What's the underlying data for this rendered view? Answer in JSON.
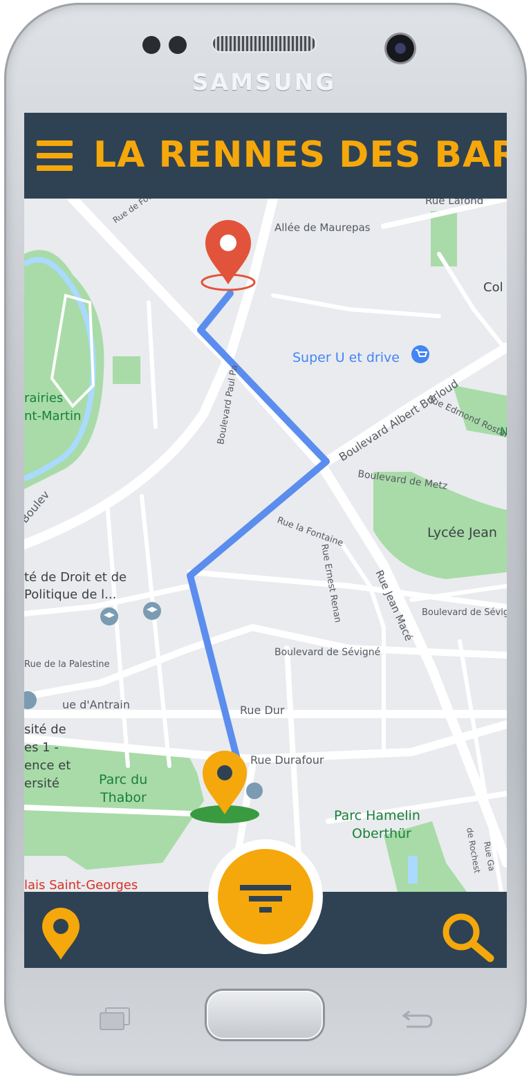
{
  "device": {
    "brand": "SAMSUNG"
  },
  "header": {
    "title": "LA RENNES DES BARS",
    "menu_icon": "menu-icon"
  },
  "map": {
    "streets": [
      "Allée de Maurepas",
      "Rue Lafond",
      "Rue de Fougères",
      "Boulevard Paul Pa",
      "Boulevard Albert Burloud",
      "Rue Edmond Rostand",
      "Boulevard de Metz",
      "Rue la Fontaine",
      "Rue Ernest Renan",
      "Rue Jean Macé",
      "Boulevard de Sévigné",
      "Boulevard de Sévigné",
      "Rue de la Palestine",
      "ue d'Antrain",
      "Rue Dur",
      "Rue Durafour",
      "Boulev",
      "de Rochest",
      "Rue Ga"
    ],
    "places": [
      {
        "name": "Super U et drive",
        "color": "#4285f4"
      },
      {
        "name": "Lycée Jean",
        "color": "#3c4043"
      },
      {
        "name": "Parc du",
        "color": "#188038"
      },
      {
        "name": "Thabor",
        "color": "#188038"
      },
      {
        "name": "Parc Hamelin",
        "color": "#188038"
      },
      {
        "name": "Oberthür",
        "color": "#188038"
      },
      {
        "name": "rairies",
        "color": "#188038"
      },
      {
        "name": "nt-Martin",
        "color": "#188038"
      },
      {
        "name": "té de Droit et de",
        "color": "#3c4043"
      },
      {
        "name": "Politique de l...",
        "color": "#3c4043"
      },
      {
        "name": "sité de",
        "color": "#3c4043"
      },
      {
        "name": "es 1 -",
        "color": "#3c4043"
      },
      {
        "name": "ence et",
        "color": "#3c4043"
      },
      {
        "name": "ersité",
        "color": "#3c4043"
      },
      {
        "name": "lais Saint-Georges",
        "color": "#d93025"
      },
      {
        "name": "Col",
        "color": "#3c4043"
      },
      {
        "name": "N",
        "color": "#188038"
      }
    ],
    "route_color": "#5b8dee",
    "destination_pin_color": "#e2533b",
    "origin_pin_color": "#f5a80b"
  },
  "bottom_bar": {
    "location_icon": "location-pin-icon",
    "filter_icon": "filter-icon",
    "search_icon": "search-icon"
  },
  "colors": {
    "header_bg": "#2f4253",
    "accent": "#f5a80b"
  }
}
